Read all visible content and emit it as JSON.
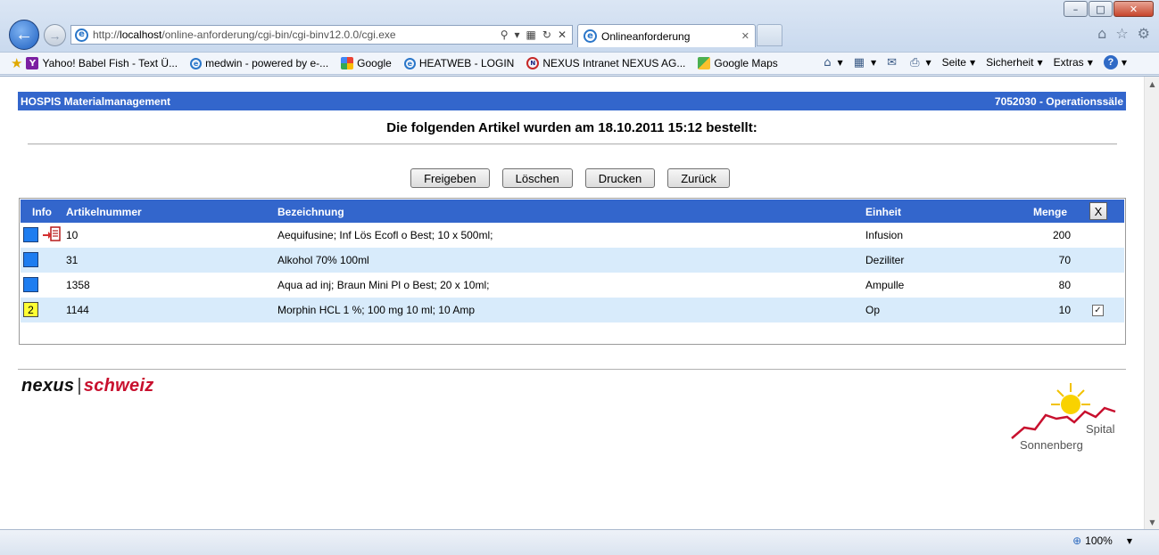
{
  "browser": {
    "window_controls": {
      "minimize": "–",
      "maximize": "□",
      "close": "✕"
    },
    "address": {
      "prefix": "http://",
      "host": "localhost",
      "path": "/online-anforderung/cgi-bin/cgi-binv12.0.0/cgi.exe"
    },
    "tab": {
      "title": "Onlineanforderung"
    },
    "favorites": [
      {
        "label": "Yahoo! Babel Fish - Text Ü...",
        "icon": "yahoo-icon"
      },
      {
        "label": "medwin - powered by e-...",
        "icon": "ie-icon"
      },
      {
        "label": "Google",
        "icon": "google-icon"
      },
      {
        "label": "HEATWEB - LOGIN",
        "icon": "ie-icon"
      },
      {
        "label": "NEXUS Intranet NEXUS AG...",
        "icon": "nexus-icon"
      },
      {
        "label": "Google Maps",
        "icon": "maps-icon"
      }
    ],
    "commands": {
      "seite": "Seite",
      "sicherheit": "Sicherheit",
      "extras": "Extras"
    },
    "zoom": "100%"
  },
  "page": {
    "header_left": "HOSPIS Materialmanagement",
    "header_right": "7052030 - Operationssäle",
    "title": "Die folgenden Artikel wurden am 18.10.2011 15:12 bestellt:",
    "buttons": {
      "freigeben": "Freigeben",
      "loeschen": "Löschen",
      "drucken": "Drucken",
      "zurueck": "Zurück"
    }
  },
  "table": {
    "headers": {
      "info": "Info",
      "artikelnummer": "Artikelnummer",
      "bezeichnung": "Bezeichnung",
      "einheit": "Einheit",
      "menge": "Menge",
      "clear": "X"
    },
    "rows": [
      {
        "info": "",
        "info_color": "#1e7df0",
        "has_doc_icon": true,
        "artikelnummer": "10",
        "bezeichnung": "Aequifusine; Inf Lös Ecofl o Best; 10 x 500ml;",
        "einheit": "Infusion",
        "menge": "200",
        "checked": false
      },
      {
        "info": "",
        "info_color": "#1e7df0",
        "has_doc_icon": false,
        "artikelnummer": "31",
        "bezeichnung": "Alkohol 70% 100ml",
        "einheit": "Deziliter",
        "menge": "70",
        "checked": false
      },
      {
        "info": "",
        "info_color": "#1e7df0",
        "has_doc_icon": false,
        "artikelnummer": "1358",
        "bezeichnung": "Aqua ad inj; Braun Mini Pl o Best; 20 x 10ml;",
        "einheit": "Ampulle",
        "menge": "80",
        "checked": false
      },
      {
        "info": "2",
        "info_color": "#ffff33",
        "has_doc_icon": false,
        "artikelnummer": "1144",
        "bezeichnung": "Morphin HCL 1 %; 100 mg 10 ml; 10 Amp",
        "einheit": "Op",
        "menge": "10",
        "checked": true
      }
    ]
  },
  "footer": {
    "logo_nexus": {
      "part1": "nexus",
      "part2": "schweiz"
    },
    "logo_spital": {
      "line1": "Spital",
      "line2": "Sonnenberg"
    }
  }
}
